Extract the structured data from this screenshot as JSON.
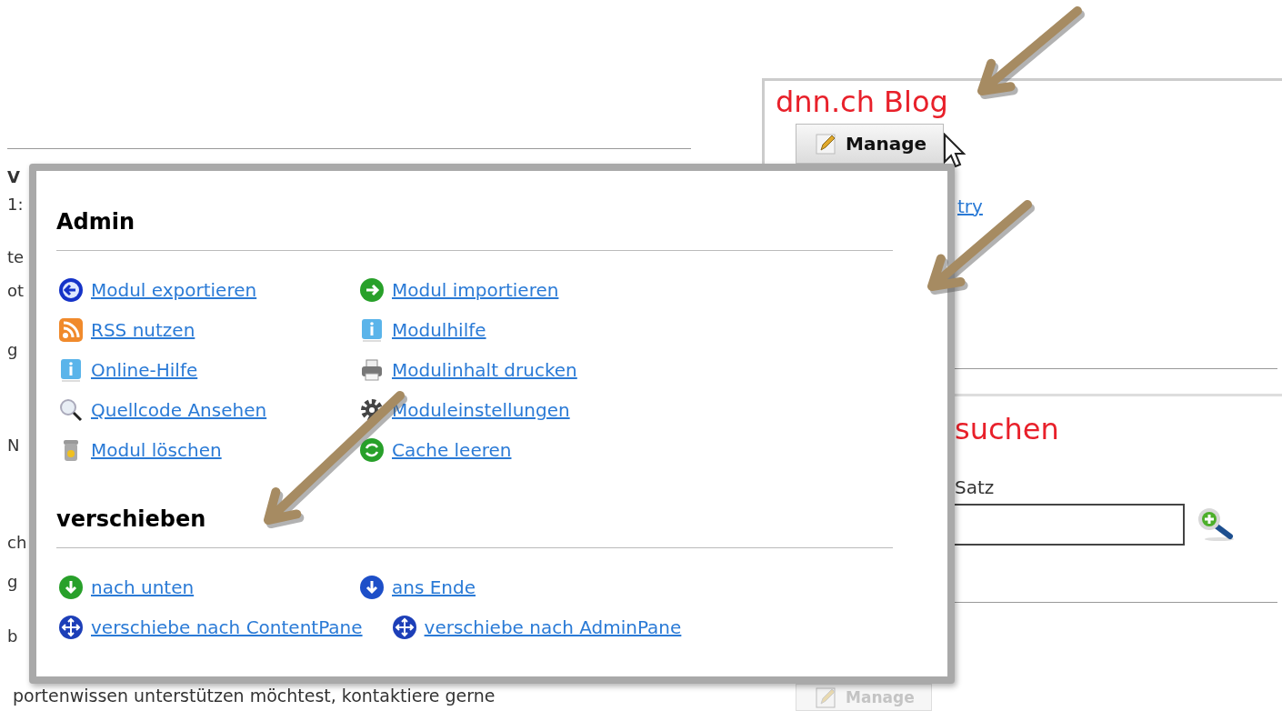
{
  "left_fragments": [
    {
      "text": "V",
      "bold": true
    },
    {
      "text": "1:",
      "bold": false
    },
    {
      "text": "te",
      "bold": false
    },
    {
      "text": "ot",
      "bold": false
    },
    {
      "text": "g",
      "bold": false
    },
    {
      "text": "N",
      "bold": false
    },
    {
      "text": "ch",
      "bold": false
    },
    {
      "text": "g",
      "bold": false
    },
    {
      "text": "b",
      "bold": false
    }
  ],
  "bottom_text": "portenwissen unterstützen möchtest, kontaktiere gerne",
  "blog_panel": {
    "title": "dnn.ch Blog",
    "link": "try"
  },
  "search_panel": {
    "title": "suchen",
    "label": "Satz"
  },
  "manage_buttons": [
    {
      "label": "Manage",
      "disabled": false
    },
    {
      "label": "Manage",
      "disabled": true
    }
  ],
  "menu": {
    "sections": [
      {
        "title": "Admin",
        "items": [
          {
            "label": "Modul exportieren",
            "kind": "export"
          },
          {
            "label": "Modul importieren",
            "kind": "import"
          },
          {
            "label": "RSS nutzen",
            "kind": "rss"
          },
          {
            "label": "Modulhilfe",
            "kind": "help"
          },
          {
            "label": "Online-Hilfe",
            "kind": "help"
          },
          {
            "label": "Modulinhalt drucken",
            "kind": "print"
          },
          {
            "label": "Quellcode Ansehen",
            "kind": "source"
          },
          {
            "label": "Moduleinstellungen",
            "kind": "settings"
          },
          {
            "label": "Modul löschen",
            "kind": "delete"
          },
          {
            "label": "Cache leeren",
            "kind": "cache"
          }
        ]
      },
      {
        "title": "verschieben",
        "items": [
          {
            "label": "nach unten",
            "kind": "down"
          },
          {
            "label": "ans Ende",
            "kind": "bottom"
          },
          {
            "label": "verschiebe nach ContentPane",
            "kind": "move"
          },
          {
            "label": "verschiebe nach AdminPane",
            "kind": "move"
          }
        ]
      }
    ]
  }
}
